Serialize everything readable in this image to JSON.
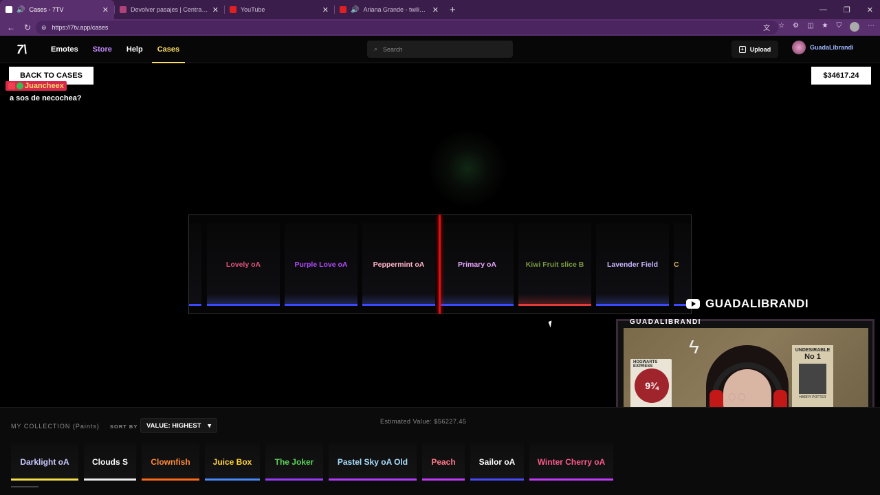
{
  "browser": {
    "tabs": [
      {
        "title": "Cases - 7TV",
        "favicon_color": "#ffffff",
        "active": true,
        "audio": true
      },
      {
        "title": "Devolver pasajes | Central de Pasajes",
        "favicon_color": "#b0427a",
        "active": false,
        "audio": false
      },
      {
        "title": "YouTube",
        "favicon_color": "#e02020",
        "active": false,
        "audio": false
      },
      {
        "title": "Ariana Grande - twilight zone",
        "favicon_color": "#e02020",
        "active": false,
        "audio": true
      }
    ],
    "url": "https://7tv.app/cases"
  },
  "site": {
    "logo": "7\\",
    "menu": [
      "Emotes",
      "Store",
      "Help",
      "Cases"
    ],
    "active_menu": "Cases",
    "search_placeholder": "Search",
    "upload_label": "Upload",
    "username": "GuadaLibrandi"
  },
  "page": {
    "back_label": "BACK TO CASES",
    "balance": "$34617.24"
  },
  "chat": {
    "user": "Juancheex",
    "message": "a sos de necochea?"
  },
  "reel": {
    "items": [
      {
        "name": "Lovely oA",
        "color": "#e0557a",
        "bar": "#3a4aff"
      },
      {
        "name": "Purple Love oA",
        "color": "#b24bff",
        "bar": "#3a4aff"
      },
      {
        "name": "Peppermint oA",
        "color": "#ffb3c6",
        "bar": "#3a4aff"
      },
      {
        "name": "Primary oA",
        "color": "#e8a7ff",
        "bar": "#3a4aff"
      },
      {
        "name": "Kiwi Fruit slice B",
        "color": "#7a9a40",
        "bar": "#e33a3a"
      },
      {
        "name": "Lavender Field",
        "color": "#c8b6ff",
        "bar": "#3a4aff"
      }
    ],
    "partial_right": "C"
  },
  "stream": {
    "channel": "GUADALIBRANDI",
    "cam_title": "GUADALIBRANDI",
    "poster1_header": "HOGWARTS EXPRESS",
    "poster1_platform": "9¾",
    "poster2_title": "UNDESIRABLE",
    "poster2_no": "No 1",
    "poster2_footer": "HARRY POTTER"
  },
  "collection": {
    "label": "MY COLLECTION (Paints)",
    "sort_label": "SORT BY",
    "sort_value": "VALUE: HIGHEST",
    "estimated": "Estimated Value: $56227.45",
    "paints": [
      {
        "name": "Darklight oA",
        "color": "#c8c8ff",
        "bar": "#f5e04a"
      },
      {
        "name": "Clouds S",
        "color": "#ffffff",
        "bar": "#f0f0f0"
      },
      {
        "name": "Clownfish",
        "color": "#ff8a3a",
        "bar": "#ff6a1a"
      },
      {
        "name": "Juice Box",
        "color": "#ffd23a",
        "bar": "#4a8aff"
      },
      {
        "name": "The Joker",
        "color": "#5ad45a",
        "bar": "#9a3aff"
      },
      {
        "name": "Pastel Sky oA Old",
        "color": "#a8e0ff",
        "bar": "#b43aff"
      },
      {
        "name": "Peach",
        "color": "#ff7a8a",
        "bar": "#c43aff"
      },
      {
        "name": "Sailor oA",
        "color": "#ffffff",
        "bar": "#4a4aff"
      },
      {
        "name": "Winter Cherry oA",
        "color": "#ff5a8a",
        "bar": "#c43aff"
      }
    ]
  }
}
